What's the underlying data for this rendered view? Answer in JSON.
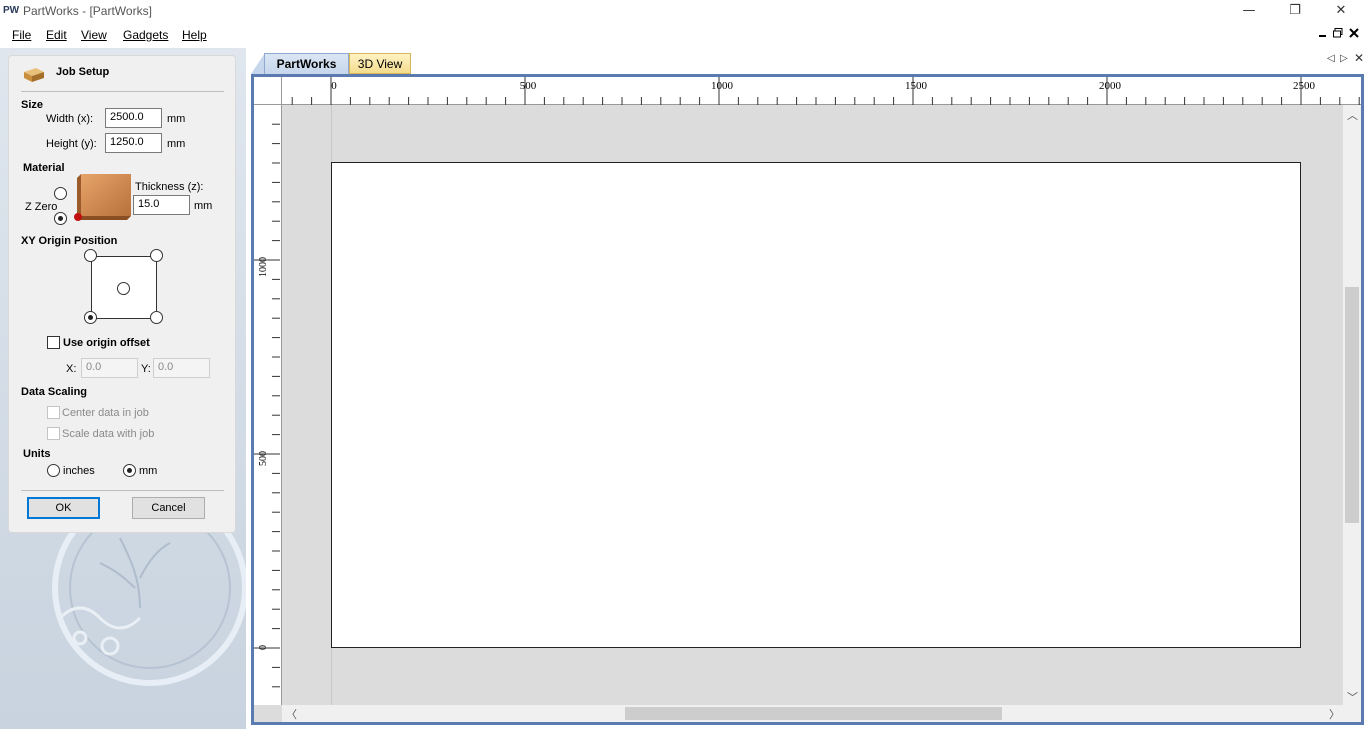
{
  "window": {
    "logo": "PW",
    "title": "PartWorks - [PartWorks]",
    "controls": [
      "—",
      "❐",
      "✕"
    ],
    "mdi_controls": [
      "▁",
      "🗗",
      "✕"
    ]
  },
  "menu": {
    "items": [
      {
        "label": "File"
      },
      {
        "label": "Edit"
      },
      {
        "label": "View"
      },
      {
        "label": "Gadgets"
      },
      {
        "label": "Help"
      }
    ]
  },
  "job_setup": {
    "title": "Job Setup",
    "size": {
      "heading": "Size",
      "width_label": "Width (x):",
      "width_value": "2500.0",
      "height_label": "Height (y):",
      "height_value": "1250.0",
      "unit": "mm"
    },
    "material": {
      "heading": "Material",
      "z_zero_label": "Z Zero",
      "z_zero_selected": "bottom",
      "thickness_label": "Thickness (z):",
      "thickness_value": "15.0",
      "unit": "mm"
    },
    "xy_origin": {
      "heading": "XY Origin Position",
      "selected": "bottom-left",
      "use_offset_label": "Use origin offset",
      "use_offset_checked": false,
      "x_label": "X:",
      "x_value": "0.0",
      "y_label": "Y:",
      "y_value": "0.0"
    },
    "data_scaling": {
      "heading": "Data Scaling",
      "center_label": "Center data in job",
      "scale_label": "Scale data with job"
    },
    "units": {
      "heading": "Units",
      "inches_label": "inches",
      "mm_label": "mm",
      "selected": "mm"
    },
    "ok_label": "OK",
    "cancel_label": "Cancel"
  },
  "tabs": [
    {
      "label": "PartWorks",
      "active": true
    },
    {
      "label": "3D View",
      "active": false
    }
  ],
  "ruler": {
    "h_labels": [
      "0",
      "500",
      "1000",
      "1500",
      "2000",
      "2500"
    ],
    "v_labels": [
      "1000",
      "500",
      "0"
    ]
  },
  "colors": {
    "frame": "#5b7bb0",
    "tab_active": "#c6d6ec",
    "tab_inactive": "#f4dc8e",
    "canvas_bg": "#dcdcdc"
  }
}
